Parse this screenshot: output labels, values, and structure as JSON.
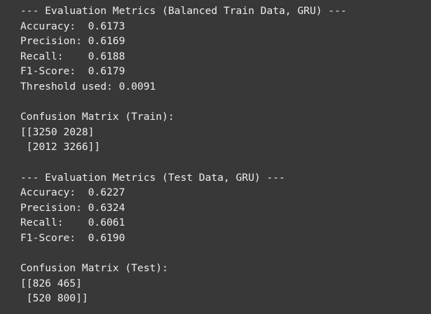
{
  "train": {
    "header": "--- Evaluation Metrics (Balanced Train Data, GRU) ---",
    "metrics": [
      "Accuracy:  0.6173",
      "Precision: 0.6169",
      "Recall:    0.6188",
      "F1-Score:  0.6179",
      "Threshold used: 0.0091"
    ],
    "confusion_title": "Confusion Matrix (Train):",
    "confusion_rows": [
      "[[3250 2028]",
      " [2012 3266]]"
    ]
  },
  "test": {
    "header": "--- Evaluation Metrics (Test Data, GRU) ---",
    "metrics": [
      "Accuracy:  0.6227",
      "Precision: 0.6324",
      "Recall:    0.6061",
      "F1-Score:  0.6190"
    ],
    "confusion_title": "Confusion Matrix (Test):",
    "confusion_rows": [
      "[[826 465]",
      " [520 800]]"
    ]
  }
}
